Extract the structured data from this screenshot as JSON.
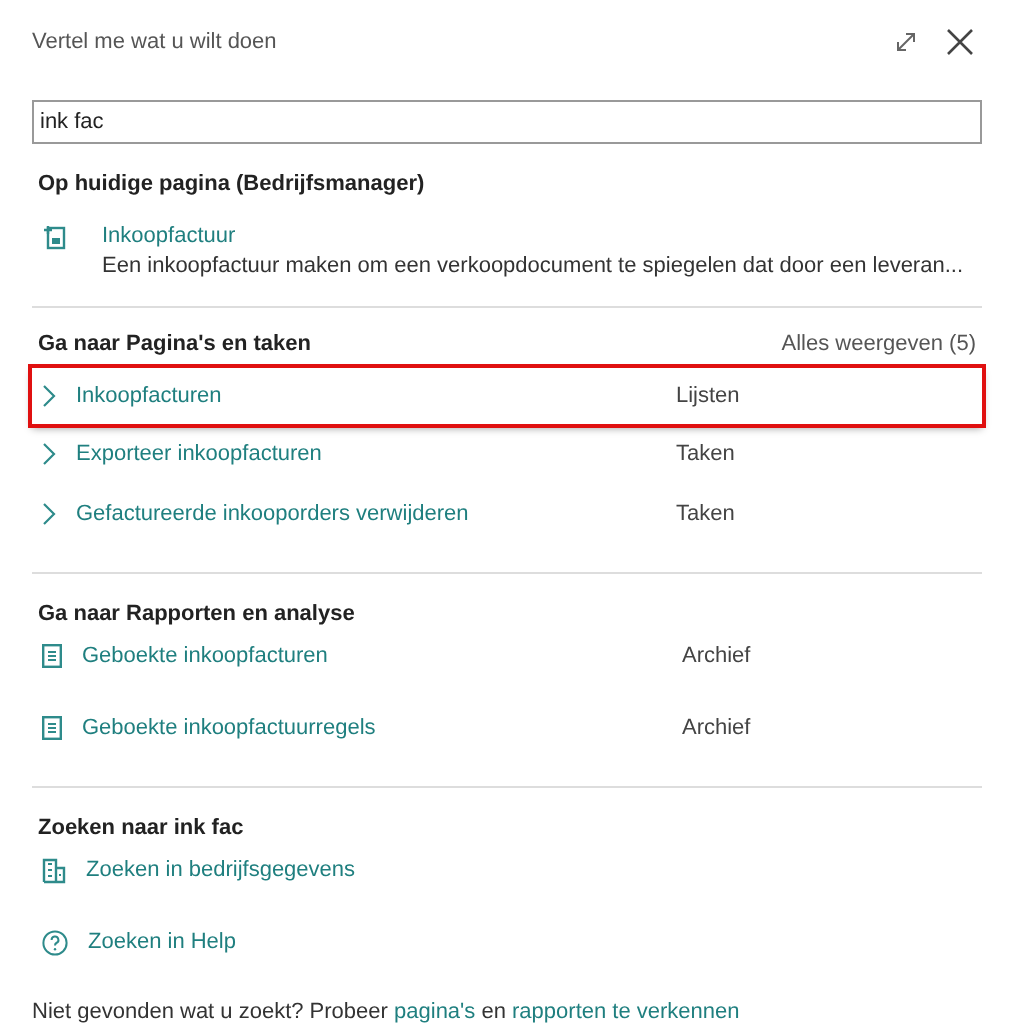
{
  "window": {
    "title": "Vertel me wat u wilt doen"
  },
  "search": {
    "value": "ink fac"
  },
  "current_page": {
    "heading": "Op huidige pagina (Bedrijfsmanager)",
    "items": [
      {
        "title": "Inkoopfactuur",
        "description": "Een inkoopfactuur maken om een verkoopdocument te spiegelen dat door een leveran..."
      }
    ]
  },
  "pages_and_tasks": {
    "heading": "Ga naar Pagina's en taken",
    "show_all": "Alles weergeven (5)",
    "items": [
      {
        "title": "Inkoopfacturen",
        "category": "Lijsten",
        "highlighted": true
      },
      {
        "title": "Exporteer inkoopfacturen",
        "category": "Taken",
        "highlighted": false
      },
      {
        "title": "Gefactureerde inkooporders verwijderen",
        "category": "Taken",
        "highlighted": false
      }
    ]
  },
  "reports": {
    "heading": "Ga naar Rapporten en analyse",
    "items": [
      {
        "title": "Geboekte inkoopfacturen",
        "category": "Archief"
      },
      {
        "title": "Geboekte inkoopfactuurregels",
        "category": "Archief"
      }
    ]
  },
  "search_for": {
    "heading": "Zoeken naar ink fac",
    "items": [
      {
        "title": "Zoeken in bedrijfsgegevens",
        "kind": "company"
      },
      {
        "title": "Zoeken in Help",
        "kind": "help"
      }
    ]
  },
  "footer": {
    "text": "Niet gevonden wat u zoekt? Probeer",
    "link_1": "pagina's",
    "middle": "en",
    "link_2": "rapporten te verkennen"
  }
}
